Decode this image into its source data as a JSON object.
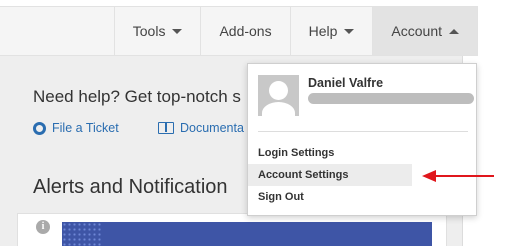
{
  "navbar": {
    "items": [
      {
        "label": "Tools",
        "has_dropdown": true
      },
      {
        "label": "Add-ons",
        "has_dropdown": false
      },
      {
        "label": "Help",
        "has_dropdown": true
      },
      {
        "label": "Account",
        "has_dropdown": true,
        "active": true
      }
    ]
  },
  "help": {
    "title": "Need help? Get top-notch s",
    "links": [
      {
        "label": "File a Ticket",
        "icon": "lifebuoy-icon"
      },
      {
        "label": "Documenta",
        "icon": "book-icon"
      }
    ]
  },
  "alerts": {
    "title": "Alerts and Notification",
    "info_icon": "i"
  },
  "account_menu": {
    "user_name": "Daniel Valfre",
    "items": [
      {
        "label": "Login Settings"
      },
      {
        "label": "Account Settings",
        "highlighted": true
      },
      {
        "label": "Sign Out"
      }
    ]
  },
  "colors": {
    "link": "#2a6db0",
    "banner": "#3e55a6",
    "annotation_arrow": "#e0161c"
  }
}
